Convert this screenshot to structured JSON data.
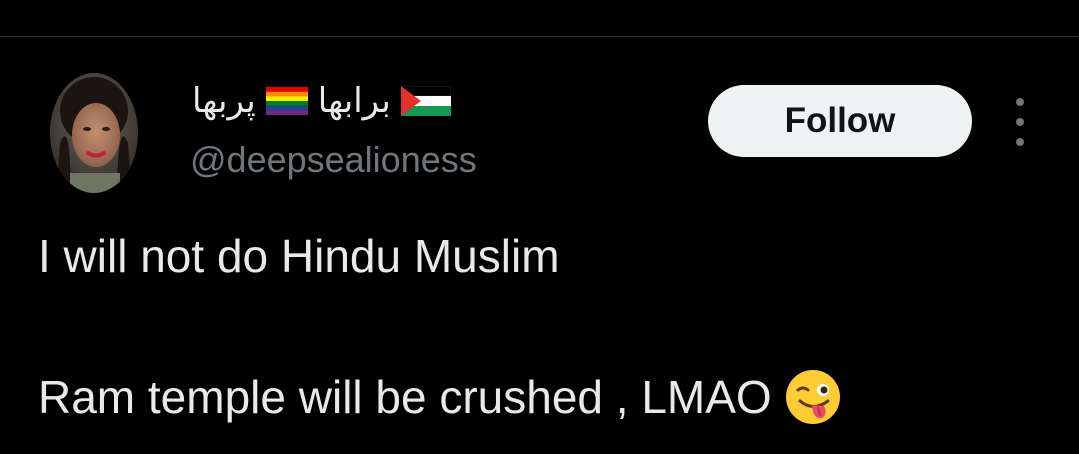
{
  "tweet": {
    "author": {
      "name_part_1": "پربھا",
      "name_part_2": "برابھا",
      "handle": "@deepsealioness"
    },
    "follow_label": "Follow",
    "text_lines": [
      "I will not do Hindu Muslim",
      "Ram temple will be crushed , LMAO"
    ],
    "emoji_name": "winking-face-with-tongue-icon"
  },
  "colors": {
    "background": "#000000",
    "text_primary": "#e7e9ea",
    "text_secondary": "#71767b",
    "follow_button_bg": "#eff3f4",
    "follow_button_text": "#0f1419",
    "divider": "#2f3336"
  },
  "icons": {
    "rainbow_flag": "rainbow-flag-icon",
    "palestine_flag": "palestine-flag-icon",
    "more_options": "more-vertical-icon"
  }
}
